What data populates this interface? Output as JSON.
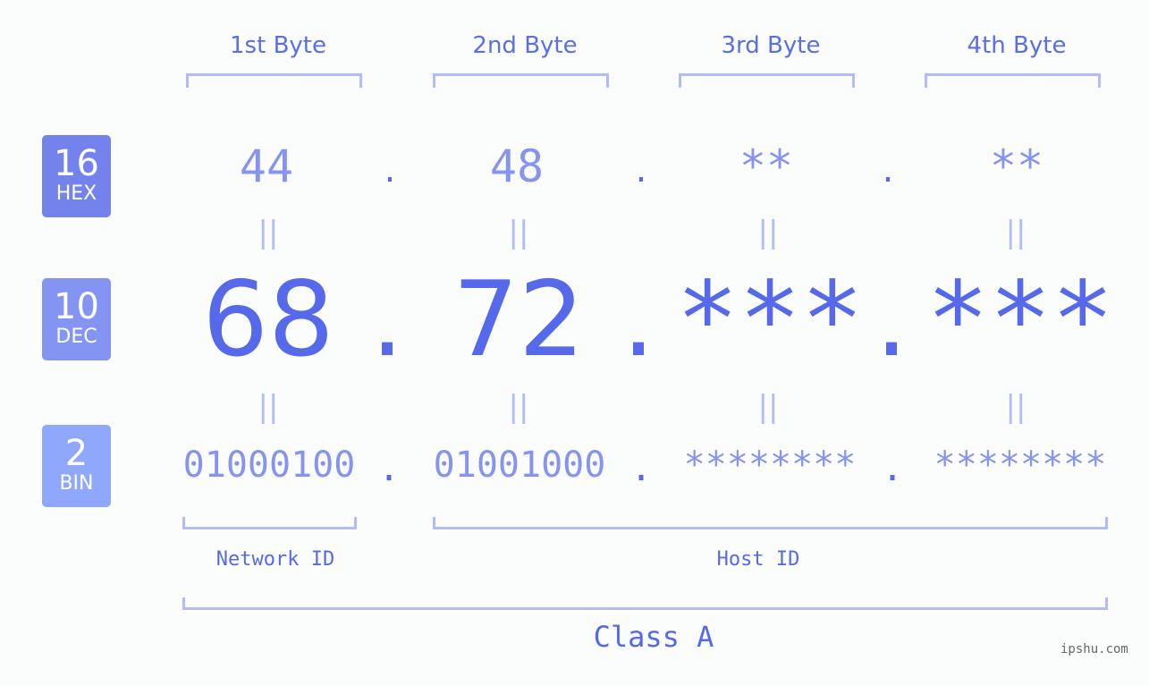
{
  "badges": {
    "hex": {
      "number": "16",
      "label": "HEX",
      "color": "#7483ec"
    },
    "dec": {
      "number": "10",
      "label": "DEC",
      "color": "#8494f2"
    },
    "bin": {
      "number": "2",
      "label": "BIN",
      "color": "#8fa8fb"
    }
  },
  "byte_headers": [
    "1st Byte",
    "2nd Byte",
    "3rd Byte",
    "4th Byte"
  ],
  "hex": [
    "44",
    "48",
    "**",
    "**"
  ],
  "dec": [
    "68",
    "72",
    "***",
    "***"
  ],
  "bin": [
    "01000100",
    "01001000",
    "********",
    "********"
  ],
  "separator": ".",
  "equals": "||",
  "network_id_label": "Network ID",
  "host_id_label": "Host ID",
  "class_label": "Class A",
  "watermark": "ipshu.com",
  "colors": {
    "accent": "#5669ea",
    "light_value": "#8694ef",
    "bracket": "#b2bcf8",
    "background": "#fbfdfc"
  }
}
